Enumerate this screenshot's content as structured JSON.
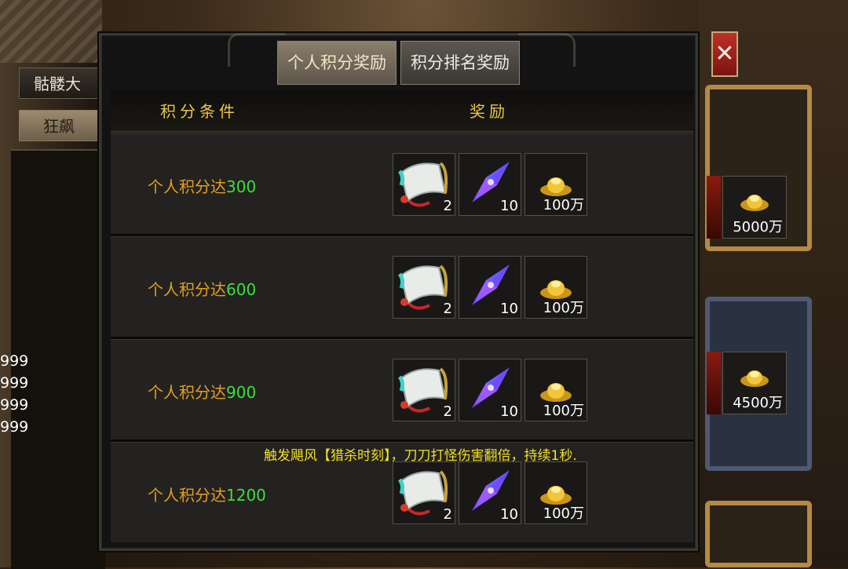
{
  "tabs": [
    {
      "label": "个人积分奖励",
      "active": true
    },
    {
      "label": "积分排名奖励",
      "active": false
    }
  ],
  "headers": {
    "condition": "积分条件",
    "reward": "奖励"
  },
  "rows": [
    {
      "condition_prefix": "个人积分达",
      "threshold": "300",
      "items": [
        {
          "icon": "scroll-icon",
          "qty": "2"
        },
        {
          "icon": "crystal-icon",
          "qty": "10"
        },
        {
          "icon": "gold-ingot-icon",
          "qty": "100万"
        }
      ]
    },
    {
      "condition_prefix": "个人积分达",
      "threshold": "600",
      "items": [
        {
          "icon": "scroll-icon",
          "qty": "2"
        },
        {
          "icon": "crystal-icon",
          "qty": "10"
        },
        {
          "icon": "gold-ingot-icon",
          "qty": "100万"
        }
      ]
    },
    {
      "condition_prefix": "个人积分达",
      "threshold": "900",
      "items": [
        {
          "icon": "scroll-icon",
          "qty": "2"
        },
        {
          "icon": "crystal-icon",
          "qty": "10"
        },
        {
          "icon": "gold-ingot-icon",
          "qty": "100万"
        }
      ]
    },
    {
      "condition_prefix": "个人积分达",
      "threshold": "1200",
      "items": [
        {
          "icon": "scroll-icon",
          "qty": "2"
        },
        {
          "icon": "crystal-icon",
          "qty": "10"
        },
        {
          "icon": "gold-ingot-icon",
          "qty": "100万"
        }
      ]
    }
  ],
  "tooltip_note": "触发飓风【猎杀时刻】，刀刀打怪伤害翻倍，持续1秒.",
  "background": {
    "left_buttons": [
      "骷髅大",
      "狂飙"
    ],
    "left_numbers": [
      "999",
      "999",
      "999",
      "999"
    ],
    "right_rewards": [
      {
        "qty": "5000万"
      },
      {
        "qty": "4500万"
      }
    ],
    "close_label": "✕"
  },
  "colors": {
    "condition_text": "#e2a022",
    "threshold": "#3ede3e",
    "header": "#e8c84a",
    "note": "#f0e02a"
  }
}
